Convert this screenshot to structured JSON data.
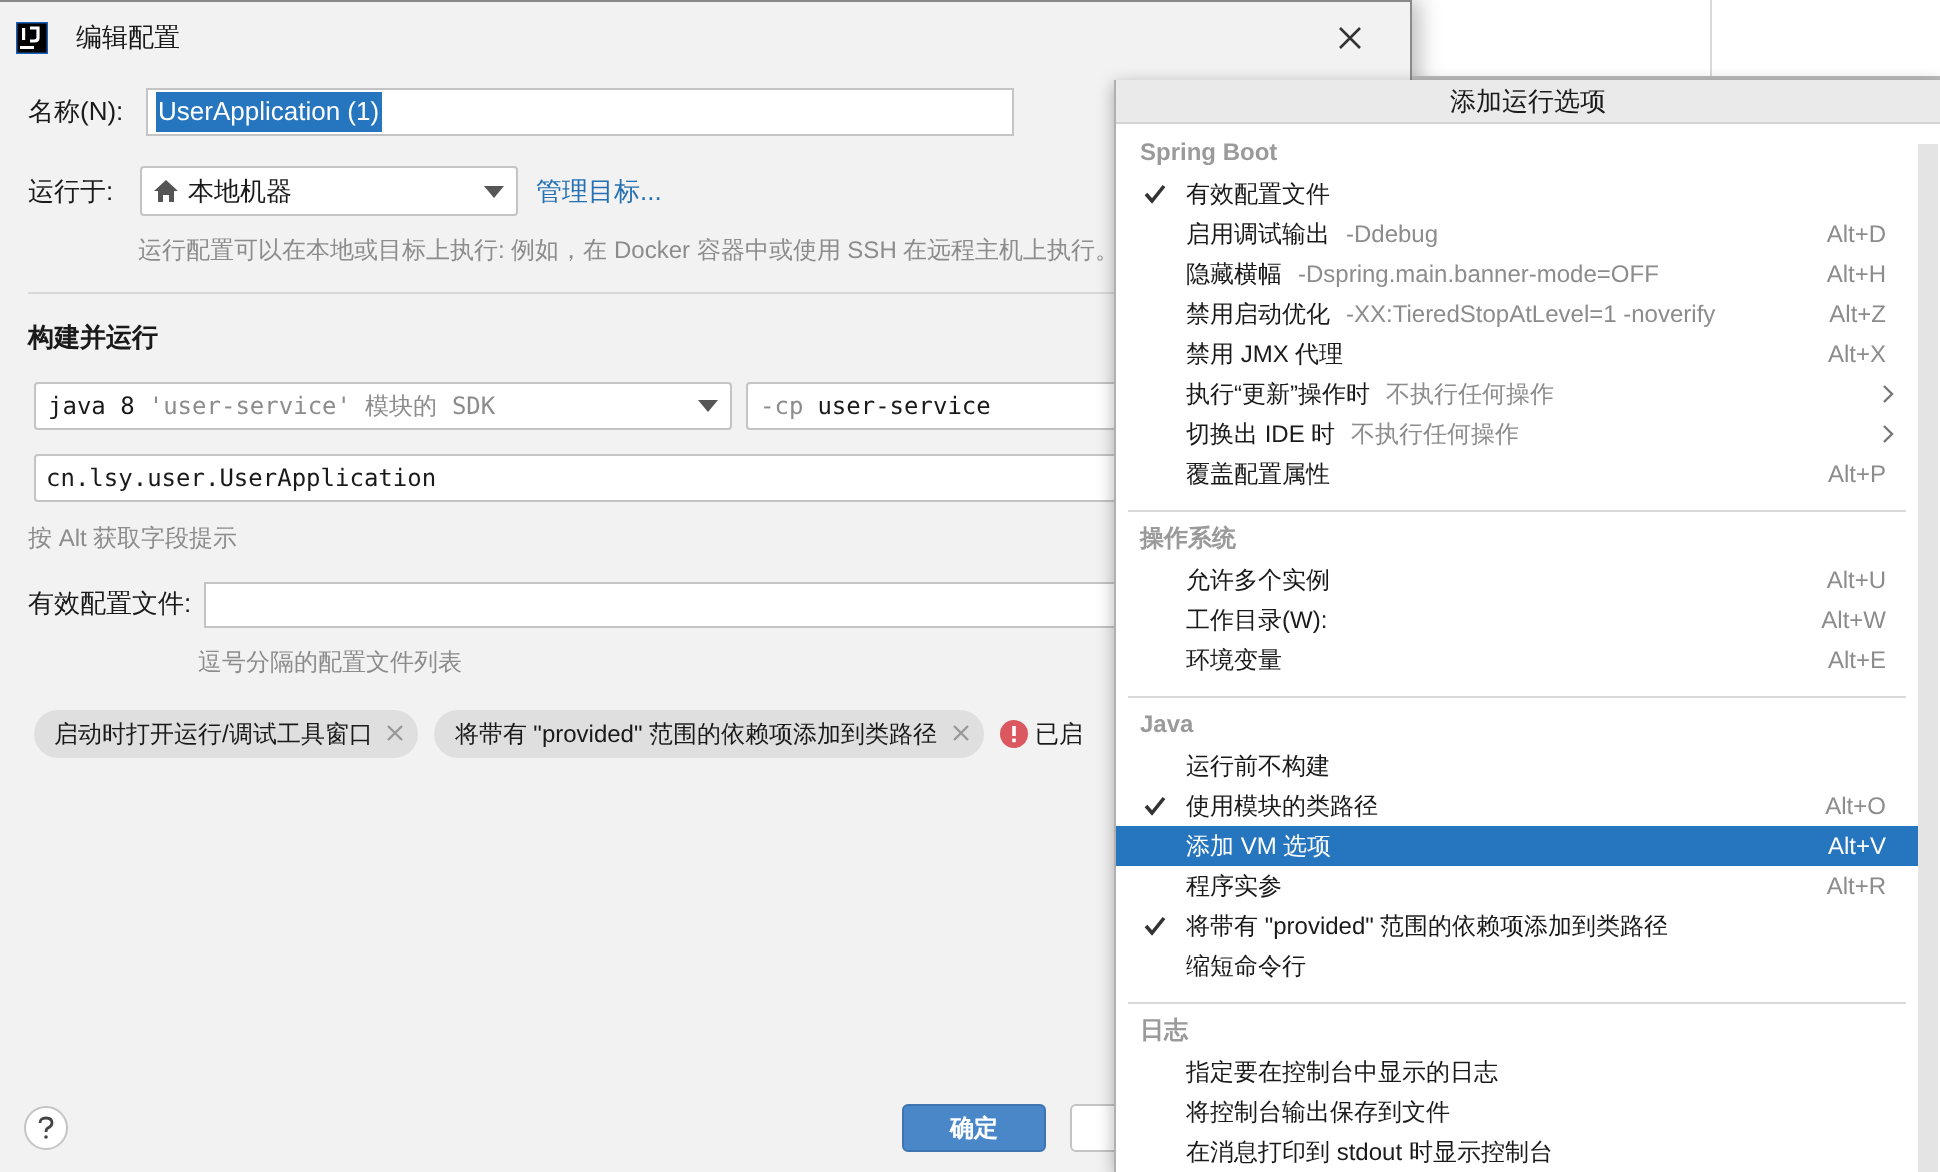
{
  "dialog": {
    "title": "编辑配置",
    "name_label": "名称(N):",
    "name_value": "UserApplication (1)",
    "name_value_selected": true,
    "run_on_label": "运行于:",
    "run_on_value": "本地机器",
    "manage_link": "管理目标...",
    "run_on_hint": "运行配置可以在本地或目标上执行: 例如，在 Docker 容器中或使用 SSH 在远程主机上执行。",
    "build_title": "构建并运行",
    "sdk": {
      "value": "java 8",
      "hint": "'user-service' 模块的 SDK"
    },
    "classpath": {
      "prefix": "-cp",
      "value": "user-service"
    },
    "main_class": "cn.lsy.user.UserApplication",
    "alt_hint": "按 Alt 获取字段提示",
    "profiles_label": "有效配置文件:",
    "profiles_hint": "逗号分隔的配置文件列表",
    "chips": [
      "启动时打开运行/调试工具窗口",
      "将带有 \"provided\" 范围的依赖项添加到类路径"
    ],
    "error_text": "已启",
    "ok_button": "确定"
  },
  "popup": {
    "title": "添加运行选项",
    "sections": [
      {
        "title": "Spring Boot",
        "items": [
          {
            "label": "有效配置文件",
            "checked": true,
            "selected": false,
            "submenu": false
          },
          {
            "label": "启用调试输出",
            "hint": "-Ddebug",
            "shortcut": "Alt+D",
            "checked": false,
            "selected": false,
            "submenu": false
          },
          {
            "label": "隐藏横幅",
            "hint": "-Dspring.main.banner-mode=OFF",
            "shortcut": "Alt+H",
            "checked": false,
            "selected": false,
            "submenu": false
          },
          {
            "label": "禁用启动优化",
            "hint": "-XX:TieredStopAtLevel=1 -noverify",
            "shortcut": "Alt+Z",
            "checked": false,
            "selected": false,
            "submenu": false
          },
          {
            "label": "禁用 JMX 代理",
            "shortcut": "Alt+X",
            "checked": false,
            "selected": false,
            "submenu": false
          },
          {
            "label": "执行“更新”操作时",
            "hint": "不执行任何操作",
            "checked": false,
            "selected": false,
            "submenu": true
          },
          {
            "label": "切换出 IDE 时",
            "hint": "不执行任何操作",
            "checked": false,
            "selected": false,
            "submenu": true
          },
          {
            "label": "覆盖配置属性",
            "shortcut": "Alt+P",
            "checked": false,
            "selected": false,
            "submenu": false
          }
        ]
      },
      {
        "title": "操作系统",
        "items": [
          {
            "label": "允许多个实例",
            "shortcut": "Alt+U",
            "checked": false,
            "selected": false,
            "submenu": false
          },
          {
            "label": "工作目录(W):",
            "shortcut": "Alt+W",
            "checked": false,
            "selected": false,
            "submenu": false
          },
          {
            "label": "环境变量",
            "shortcut": "Alt+E",
            "checked": false,
            "selected": false,
            "submenu": false
          }
        ]
      },
      {
        "title": "Java",
        "items": [
          {
            "label": "运行前不构建",
            "checked": false,
            "selected": false,
            "submenu": false
          },
          {
            "label": "使用模块的类路径",
            "shortcut": "Alt+O",
            "checked": true,
            "selected": false,
            "submenu": false
          },
          {
            "label": "添加 VM 选项",
            "shortcut": "Alt+V",
            "checked": false,
            "selected": true,
            "submenu": false
          },
          {
            "label": "程序实参",
            "shortcut": "Alt+R",
            "checked": false,
            "selected": false,
            "submenu": false
          },
          {
            "label": "将带有 \"provided\" 范围的依赖项添加到类路径",
            "checked": true,
            "selected": false,
            "submenu": false
          },
          {
            "label": "缩短命令行",
            "checked": false,
            "selected": false,
            "submenu": false
          }
        ]
      },
      {
        "title": "日志",
        "items": [
          {
            "label": "指定要在控制台中显示的日志",
            "checked": false,
            "selected": false,
            "submenu": false
          },
          {
            "label": "将控制台输出保存到文件",
            "checked": false,
            "selected": false,
            "submenu": false
          },
          {
            "label": "在消息打印到 stdout 时显示控制台",
            "checked": false,
            "selected": false,
            "submenu": false
          }
        ]
      }
    ]
  }
}
